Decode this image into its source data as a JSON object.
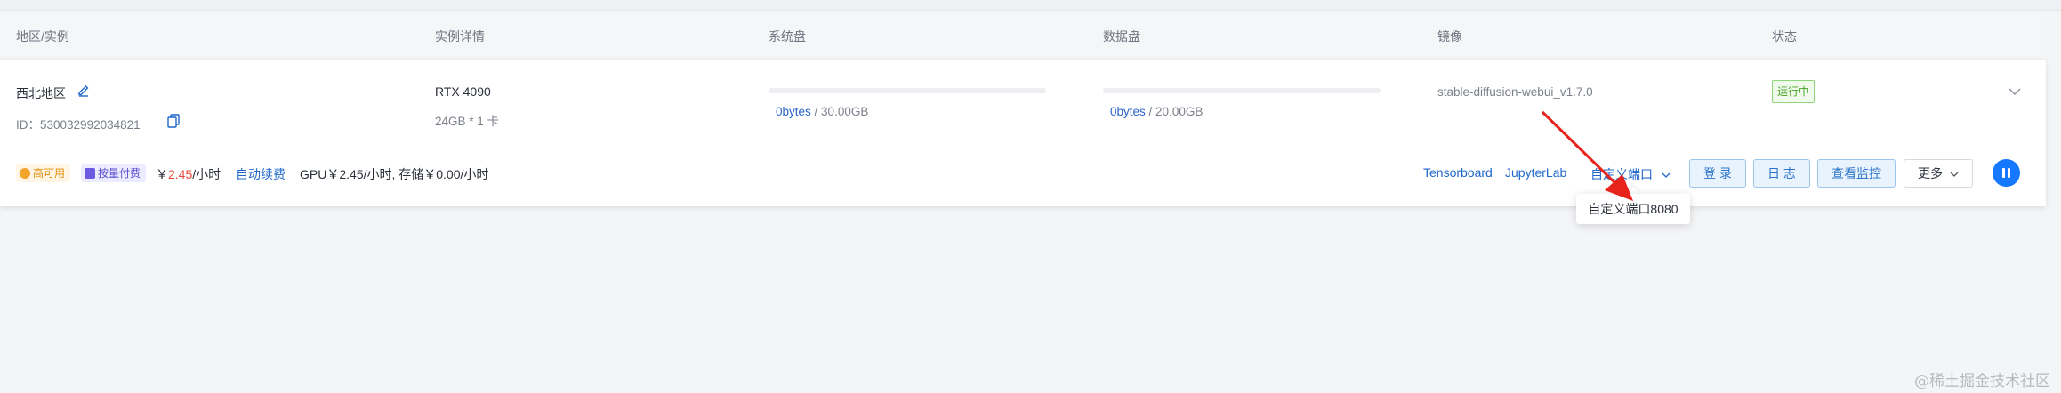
{
  "header": {
    "col_region": "地区/实例",
    "col_detail": "实例详情",
    "col_system_disk": "系统盘",
    "col_data_disk": "数据盘",
    "col_image": "镜像",
    "col_status": "状态"
  },
  "instance": {
    "region": "西北地区",
    "id_label": "ID：530032992034821",
    "gpu_model": "RTX 4090",
    "gpu_spec": "24GB * 1 卡",
    "system_disk": {
      "used": "0bytes",
      "total": "/ 30.00GB",
      "used_fraction": 0
    },
    "data_disk": {
      "used": "0bytes",
      "total": "/ 20.00GB",
      "used_fraction": 0
    },
    "image": "stable-diffusion-webui_v1.7.0",
    "status": "运行中",
    "status_color": "#46a32a"
  },
  "billing": {
    "tag_ha": "高可用",
    "tag_pay": "按量付费",
    "price_prefix": "￥",
    "price_value": "2.45",
    "price_unit": "/小时",
    "auto_renew": "自动续费",
    "detail": "GPU￥2.45/小时, 存储￥0.00/小时",
    "price_color": "#e8463a"
  },
  "actions": {
    "tensorboard": "Tensorboard",
    "jupyterlab": "JupyterLab",
    "custom_port": "自定义端口",
    "login": "登 录",
    "log": "日 志",
    "monitor": "查看监控",
    "more": "更多"
  },
  "popup": {
    "item": "自定义端口8080"
  },
  "icons": {
    "edit": "edit-icon",
    "copy": "copy-icon",
    "expand": "chevron-down-icon",
    "pause": "pause-icon"
  },
  "accent_color": "#1677ff",
  "annotation_arrow_color": "#e8231c",
  "watermark": "@稀土掘金技术社区"
}
